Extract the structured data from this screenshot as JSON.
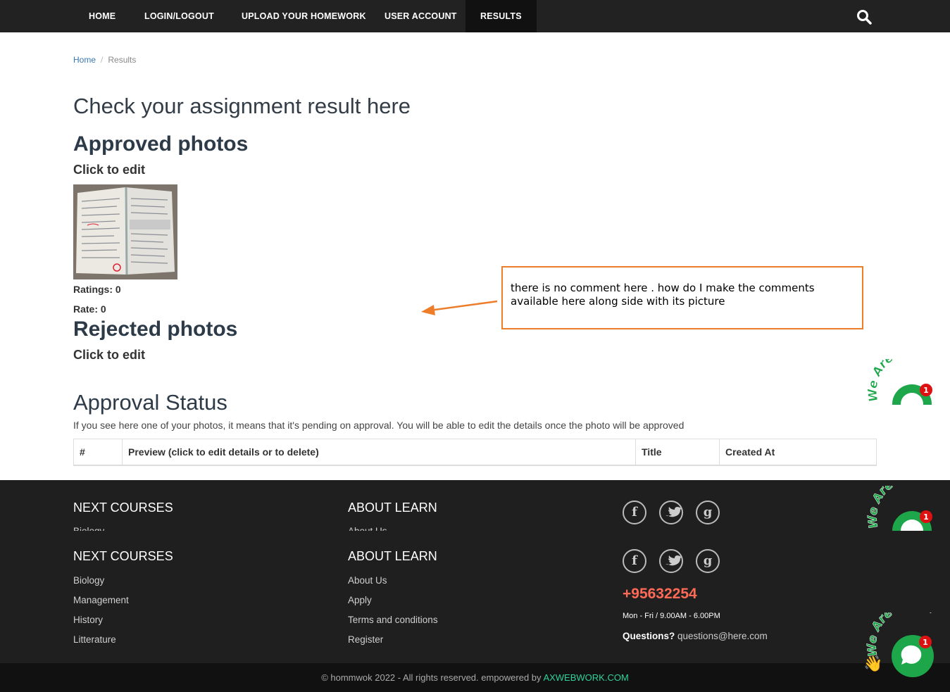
{
  "nav": {
    "items": [
      {
        "label": "HOME"
      },
      {
        "label": "LOGIN/LOGOUT"
      },
      {
        "label": "UPLOAD YOUR HOMEWORK"
      },
      {
        "label": "USER ACCOUNT"
      },
      {
        "label": "RESULTS"
      }
    ],
    "active": "RESULTS"
  },
  "breadcrumb": {
    "home": "Home",
    "separator": "/",
    "current": "Results"
  },
  "main": {
    "title": "Check your assignment result here",
    "approved": {
      "heading": "Approved photos",
      "click_to_edit": "Click to edit",
      "ratings": "Ratings: 0",
      "rate": "Rate: 0"
    },
    "rejected": {
      "heading": "Rejected photos",
      "click_to_edit": "Click to edit"
    },
    "approval": {
      "heading": "Approval Status",
      "description": "If you see here one of your photos, it means that it's pending on approval. You will be able to edit the details once the photo will be approved",
      "columns": [
        "#",
        "Preview (click to edit details or to delete)",
        "Title",
        "Created At"
      ]
    }
  },
  "annotation": {
    "text": "there is no comment here . how do I make the comments available here along side with its picture"
  },
  "footer": {
    "courses": {
      "heading": "NEXT COURSES",
      "links": [
        "Biology",
        "Management",
        "History",
        "Litterature"
      ]
    },
    "about": {
      "heading": "ABOUT LEARN",
      "links": [
        "About Us",
        "Apply",
        "Terms and conditions",
        "Register"
      ]
    },
    "social_icons": [
      "facebook-icon",
      "twitter-icon",
      "google-icon"
    ],
    "phone": "+95632254",
    "hours": "Mon - Fri / 9.00AM - 6.00PM",
    "questions_label": "Questions?",
    "email": "questions@here.com",
    "copyright": "© hommwok 2022 - All rights reserved. empowered by",
    "credit": "AXWEBWORK.COM"
  },
  "chat_widget": {
    "text": "We Are Here!",
    "badge_count": "1"
  },
  "colors": {
    "nav_bg": "#222222",
    "footer_bg": "#1f1f1f",
    "accent_phone": "#ff6a57",
    "credit": "#2ed29b",
    "chat": "#1ea64a",
    "annotation": "#ee7d2a"
  }
}
